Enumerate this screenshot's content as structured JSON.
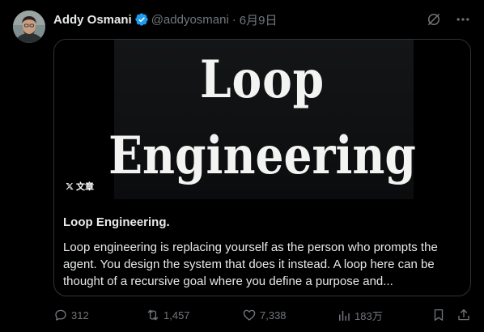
{
  "tweet": {
    "author_name": "Addy Osmani",
    "handle": "@addyosmani",
    "separator": "·",
    "date": "6月9日",
    "avatar": "avatar-photo",
    "verified_icon": "verified-badge-icon"
  },
  "top_icons": {
    "grok": "grok-icon",
    "more": "more-icon"
  },
  "article": {
    "cover_line_1": "Loop",
    "cover_line_2": "Engineering",
    "badge_label": "文章",
    "title": "Loop Engineering.",
    "excerpt": "Loop engineering is replacing yourself as the person who prompts the agent. You design the system that does it instead. A loop here can be thought of a recursive goal where you define a purpose and..."
  },
  "actions": {
    "replies": "312",
    "reposts": "1,457",
    "likes": "7,338",
    "views": "183万"
  },
  "colors": {
    "background": "#000000",
    "text": "#e7e9ea",
    "muted": "#71767b",
    "border": "#2f3336",
    "verified": "#1d9bf0"
  }
}
